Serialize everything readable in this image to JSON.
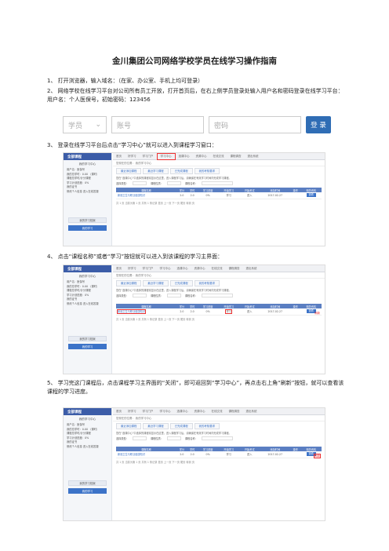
{
  "doc": {
    "title": "金川集团公司网络学校学员在线学习操作指南",
    "steps": [
      "1、 打开浏览器，输入域名：（在家、办公室、手机上均可登录）",
      "2、 网络学校在线学习平台对公司所有员工开放，打开首页后，在右上侧学员登录处输入用户名和密码登录在线学习平台：用户名：个人医保号，初始密码：123456",
      "3、 登录在线学习平台后点击“学习中心”就可以进入到课程学习窗口：",
      "4、 点击“课程名称”或者“学习”按钮就可以进入到该课程的学习主界面：",
      "5、 学习完这门课程后，点击课程学习主界面的“关闭”，即可返回到“学习中心”，再点击右上角“刷新”按钮，就可以查看该课程的学习进度。"
    ]
  },
  "login": {
    "role": "学员",
    "account_placeholder": "账号",
    "password_placeholder": "密码",
    "submit": "登 录"
  },
  "portal": {
    "brand": "全部课程",
    "side_title": "我的学习中心",
    "side_rows": [
      "用户名：医保号",
      "我的总学时：0.00 （课时）",
      "课程总学时/计分课程",
      "学习计划进度：0%",
      "我的证书",
      "修改个人信息  进入在线答疑"
    ],
    "side_btn": "我的学习档案",
    "side_btn_active": "我的学习",
    "nav": [
      "首页",
      "好学习",
      "学习门户",
      "学习中心",
      "选课中心",
      "资源中心",
      "在线交流",
      "课程调查",
      "退出系统"
    ],
    "crumb": "您现在的位置： 我的学习中心",
    "tabs": [
      "最近添加课程",
      "最近学习课程",
      "已完成课程",
      "我的考核要求"
    ],
    "note": "您在“选课中心”中选择的课程将显示在这里，进入课程学习后，请确保在有效学习时间内完成学习课程。",
    "filter": [
      "选择类型：",
      "全部",
      "课程性质：",
      "全部",
      "课程名称：",
      "输入课程名称"
    ],
    "refresh": "刷新",
    "columns": [
      "课程名称",
      "学分",
      "学时",
      "学习进度",
      "开始学习",
      "开始考试",
      "添加时间",
      "操作",
      "相关资料"
    ],
    "row": [
      "新冠卫生与职业健康知识",
      "2.0",
      "2.0",
      "0%",
      "学习",
      "进入",
      "2017-02-27",
      "",
      "查看"
    ],
    "pager": "共 1 页   当前为第 1 页   共有 1 条记录   首页   上一页   下一页   尾页   转到   页"
  }
}
